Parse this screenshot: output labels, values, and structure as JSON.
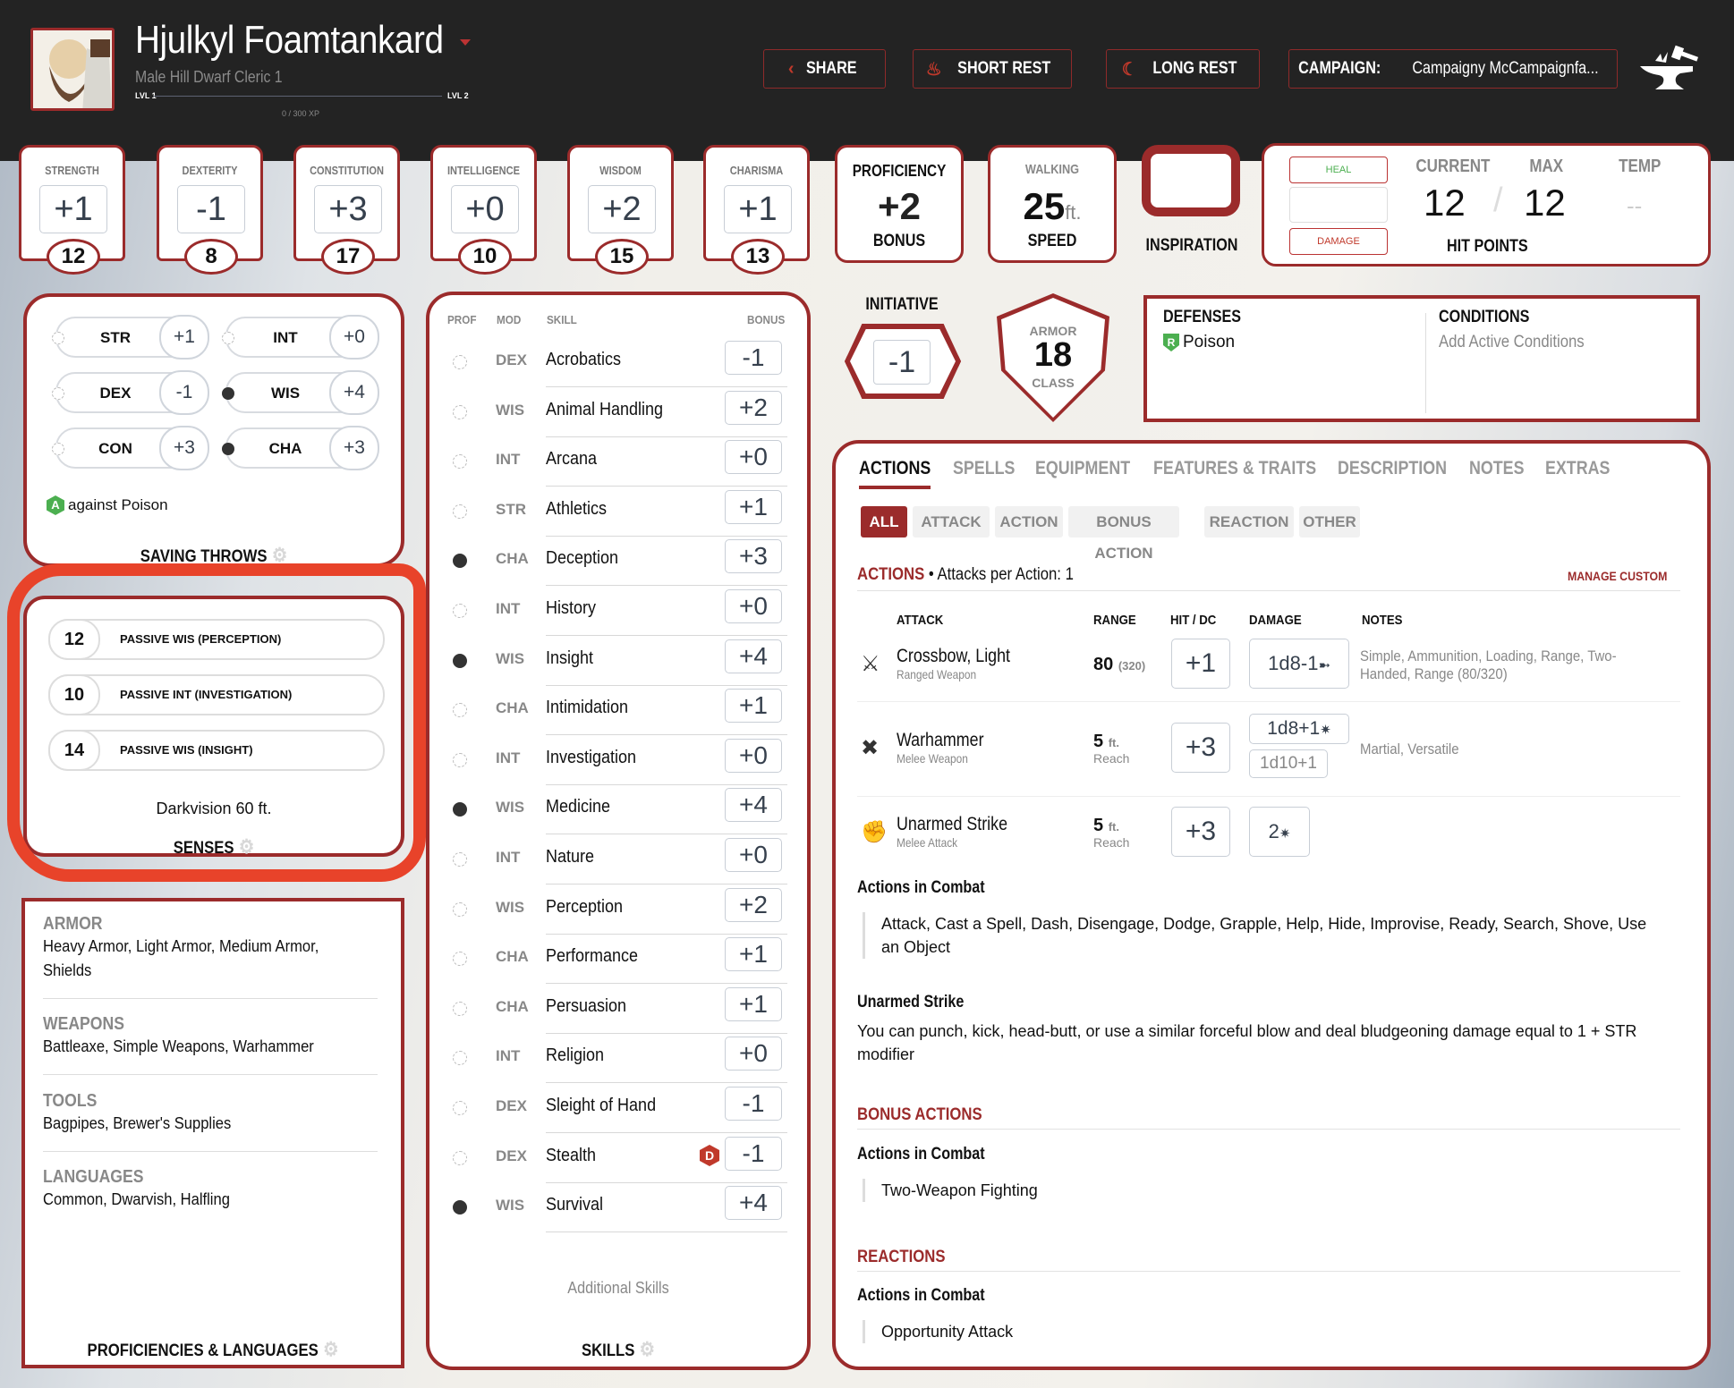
{
  "header": {
    "name": "Hjulkyl Foamtankard",
    "subtitle": "Male  Hill Dwarf  Cleric 1",
    "level_left": "LVL 1",
    "level_right": "LVL 2",
    "xp": "0 / 300 XP",
    "xp_progress": 0,
    "buttons": {
      "share": "SHARE",
      "short_rest": "SHORT REST",
      "long_rest": "LONG REST",
      "campaign_label": "CAMPAIGN:",
      "campaign_value": "Campaigny McCampaignfa..."
    }
  },
  "abilities": [
    {
      "name": "STRENGTH",
      "mod": "+1",
      "score": "12"
    },
    {
      "name": "DEXTERITY",
      "mod": "-1",
      "score": "8"
    },
    {
      "name": "CONSTITUTION",
      "mod": "+3",
      "score": "17"
    },
    {
      "name": "INTELLIGENCE",
      "mod": "+0",
      "score": "10"
    },
    {
      "name": "WISDOM",
      "mod": "+2",
      "score": "15"
    },
    {
      "name": "CHARISMA",
      "mod": "+1",
      "score": "13"
    }
  ],
  "proficiency": {
    "top": "PROFICIENCY",
    "value": "+2",
    "bottom": "BONUS"
  },
  "speed": {
    "top": "WALKING",
    "value": "25",
    "unit": "ft.",
    "bottom": "SPEED"
  },
  "inspiration": {
    "label": "INSPIRATION"
  },
  "hit_points": {
    "heal": "HEAL",
    "damage": "DAMAGE",
    "current_label": "CURRENT",
    "max_label": "MAX",
    "temp_label": "TEMP",
    "current": "12",
    "max": "12",
    "temp": "--",
    "sep": "/",
    "title": "HIT POINTS"
  },
  "initiative": {
    "label": "INITIATIVE",
    "value": "-1"
  },
  "armor_class": {
    "top": "ARMOR",
    "value": "18",
    "bottom": "CLASS"
  },
  "defenses": {
    "title": "DEFENSES",
    "items": [
      {
        "badge": "R",
        "text": "Poison"
      }
    ]
  },
  "conditions": {
    "title": "CONDITIONS",
    "placeholder": "Add Active Conditions"
  },
  "saving_throws": {
    "title": "SAVING THROWS",
    "items": [
      {
        "abbr": "STR",
        "value": "+1",
        "proficient": false
      },
      {
        "abbr": "INT",
        "value": "+0",
        "proficient": false
      },
      {
        "abbr": "DEX",
        "value": "-1",
        "proficient": false
      },
      {
        "abbr": "WIS",
        "value": "+4",
        "proficient": true
      },
      {
        "abbr": "CON",
        "value": "+3",
        "proficient": false
      },
      {
        "abbr": "CHA",
        "value": "+3",
        "proficient": true
      }
    ],
    "advantage_badge": "A",
    "advantage_note": "against Poison"
  },
  "senses": {
    "title": "SENSES",
    "items": [
      {
        "value": "12",
        "label": "PASSIVE WIS (PERCEPTION)"
      },
      {
        "value": "10",
        "label": "PASSIVE INT (INVESTIGATION)"
      },
      {
        "value": "14",
        "label": "PASSIVE WIS (INSIGHT)"
      }
    ],
    "note": "Darkvision 60 ft."
  },
  "proficiencies": {
    "title": "PROFICIENCIES & LANGUAGES",
    "groups": [
      {
        "heading": "ARMOR",
        "value": "Heavy Armor, Light Armor, Medium Armor, Shields"
      },
      {
        "heading": "WEAPONS",
        "value": "Battleaxe, Simple Weapons, Warhammer"
      },
      {
        "heading": "TOOLS",
        "value": "Bagpipes, Brewer's Supplies"
      },
      {
        "heading": "LANGUAGES",
        "value": "Common, Dwarvish, Halfling"
      }
    ]
  },
  "skills": {
    "title": "SKILLS",
    "headers": {
      "prof": "PROF",
      "mod": "MOD",
      "skill": "SKILL",
      "bonus": "BONUS"
    },
    "items": [
      {
        "mod": "DEX",
        "name": "Acrobatics",
        "bonus": "-1",
        "proficient": false
      },
      {
        "mod": "WIS",
        "name": "Animal Handling",
        "bonus": "+2",
        "proficient": false
      },
      {
        "mod": "INT",
        "name": "Arcana",
        "bonus": "+0",
        "proficient": false
      },
      {
        "mod": "STR",
        "name": "Athletics",
        "bonus": "+1",
        "proficient": false
      },
      {
        "mod": "CHA",
        "name": "Deception",
        "bonus": "+3",
        "proficient": true
      },
      {
        "mod": "INT",
        "name": "History",
        "bonus": "+0",
        "proficient": false
      },
      {
        "mod": "WIS",
        "name": "Insight",
        "bonus": "+4",
        "proficient": true
      },
      {
        "mod": "CHA",
        "name": "Intimidation",
        "bonus": "+1",
        "proficient": false
      },
      {
        "mod": "INT",
        "name": "Investigation",
        "bonus": "+0",
        "proficient": false
      },
      {
        "mod": "WIS",
        "name": "Medicine",
        "bonus": "+4",
        "proficient": true
      },
      {
        "mod": "INT",
        "name": "Nature",
        "bonus": "+0",
        "proficient": false
      },
      {
        "mod": "WIS",
        "name": "Perception",
        "bonus": "+2",
        "proficient": false
      },
      {
        "mod": "CHA",
        "name": "Performance",
        "bonus": "+1",
        "proficient": false
      },
      {
        "mod": "CHA",
        "name": "Persuasion",
        "bonus": "+1",
        "proficient": false
      },
      {
        "mod": "INT",
        "name": "Religion",
        "bonus": "+0",
        "proficient": false
      },
      {
        "mod": "DEX",
        "name": "Sleight of Hand",
        "bonus": "-1",
        "proficient": false
      },
      {
        "mod": "DEX",
        "name": "Stealth",
        "bonus": "-1",
        "proficient": false,
        "disadvantage": "D"
      },
      {
        "mod": "WIS",
        "name": "Survival",
        "bonus": "+4",
        "proficient": true
      }
    ],
    "additional": "Additional Skills"
  },
  "tabs": [
    "ACTIONS",
    "SPELLS",
    "EQUIPMENT",
    "FEATURES & TRAITS",
    "DESCRIPTION",
    "NOTES",
    "EXTRAS"
  ],
  "filters": [
    "ALL",
    "ATTACK",
    "ACTION",
    "BONUS ACTION",
    "REACTION",
    "OTHER"
  ],
  "actions": {
    "title": "ACTIONS",
    "attacks_per_action": "• Attacks per Action: 1",
    "manage_custom": "MANAGE CUSTOM",
    "columns": {
      "attack": "ATTACK",
      "range": "RANGE",
      "hit": "HIT / DC",
      "damage": "DAMAGE",
      "notes": "NOTES"
    },
    "attacks": [
      {
        "name": "Crossbow, Light",
        "type": "Ranged Weapon",
        "range": "80",
        "range_long": "(320)",
        "range_sub": "",
        "hit": "+1",
        "damage": "1d8-1",
        "damage_alt": "",
        "notes": "Simple, Ammunition, Loading, Range, Two-Handed, Range (80/320)"
      },
      {
        "name": "Warhammer",
        "type": "Melee Weapon",
        "range": "5",
        "range_unit": "ft.",
        "range_sub": "Reach",
        "hit": "+3",
        "damage": "1d8+1",
        "damage_alt": "1d10+1",
        "notes": "Martial, Versatile"
      },
      {
        "name": "Unarmed Strike",
        "type": "Melee Attack",
        "range": "5",
        "range_unit": "ft.",
        "range_sub": "Reach",
        "hit": "+3",
        "damage": "2",
        "damage_alt": "",
        "notes": ""
      }
    ],
    "combat_heading": "Actions in Combat",
    "combat_list": "Attack, Cast a Spell, Dash, Disengage, Dodge, Grapple, Help, Hide, Improvise, Ready, Search, Shove, Use an Object",
    "unarmed_heading": "Unarmed Strike",
    "unarmed_text": "You can punch, kick, head-butt, or use a similar forceful blow and deal bludgeoning damage equal to 1 + STR modifier"
  },
  "bonus_actions": {
    "title": "BONUS ACTIONS",
    "heading": "Actions in Combat",
    "item": "Two-Weapon Fighting"
  },
  "reactions": {
    "title": "REACTIONS",
    "heading": "Actions in Combat",
    "item": "Opportunity Attack"
  }
}
